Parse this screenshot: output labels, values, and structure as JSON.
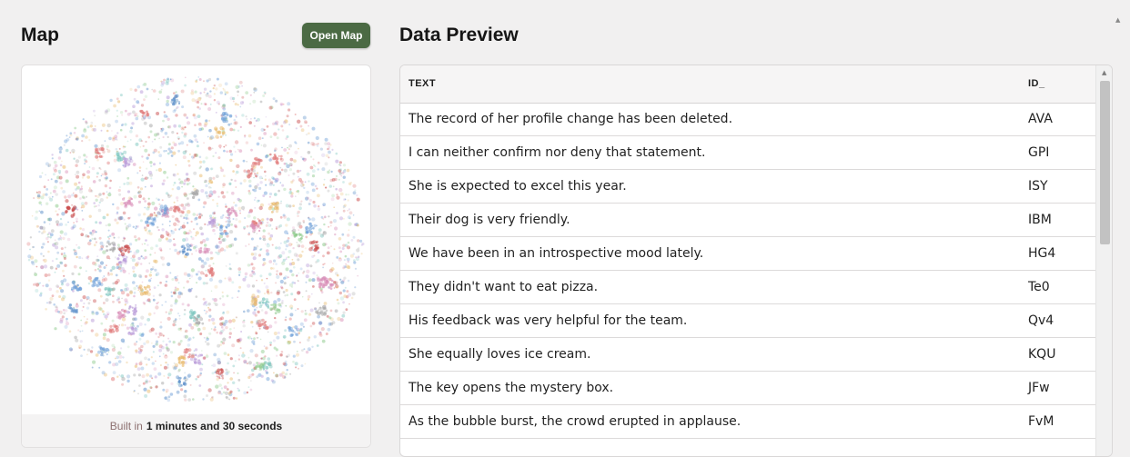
{
  "map": {
    "heading": "Map",
    "open_button": "Open Map",
    "footer_prefix": "Built in",
    "footer_duration": "1 minutes and 30 seconds"
  },
  "preview": {
    "heading": "Data Preview",
    "columns": [
      "TEXT",
      "ID_"
    ],
    "rows": [
      {
        "text": "The record of her profile change has been deleted.",
        "id": "AVA"
      },
      {
        "text": "I can neither confirm nor deny that statement.",
        "id": "GPI"
      },
      {
        "text": "She is expected to excel this year.",
        "id": "ISY"
      },
      {
        "text": "Their dog is very friendly.",
        "id": "IBM"
      },
      {
        "text": "We have been in an introspective mood lately.",
        "id": "HG4"
      },
      {
        "text": "They didn't want to eat pizza.",
        "id": "Te0"
      },
      {
        "text": "His feedback was very helpful for the team.",
        "id": "Qv4"
      },
      {
        "text": "She equally loves ice cream.",
        "id": "KQU"
      },
      {
        "text": "The key opens the mystery box.",
        "id": "JFw"
      },
      {
        "text": "As the bubble burst, the crowd erupted in applause.",
        "id": "FvM"
      },
      {
        "text": "",
        "id": ""
      }
    ]
  },
  "colors": {
    "accent_button": "#4b6a44",
    "footer_muted": "#8c7070",
    "map_points": [
      "#e07a7a",
      "#6fa0d8",
      "#8cc98a",
      "#e8b96a",
      "#b89ad8",
      "#7fc7c0",
      "#d98fb8",
      "#a8a8a8",
      "#c94a4a",
      "#5c8fc9"
    ]
  },
  "icons": {
    "page_scroll": "scroll-up-arrow-icon",
    "table_scroll": "scroll-up-arrow-icon"
  }
}
